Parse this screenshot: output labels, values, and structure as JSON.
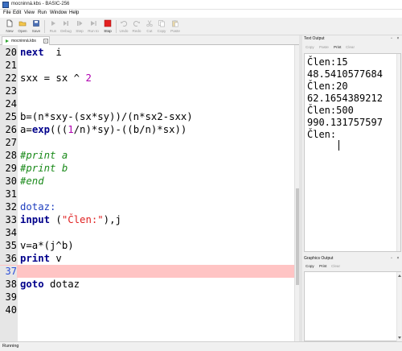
{
  "window": {
    "title": "mocninná.kbs - BASIC-256"
  },
  "menu": [
    "File",
    "Edit",
    "View",
    "Run",
    "Window",
    "Help"
  ],
  "toolbar": {
    "buttons": [
      {
        "label": "New",
        "icon": "new-file-icon",
        "enabled": true
      },
      {
        "label": "Open",
        "icon": "open-folder-icon",
        "enabled": true
      },
      {
        "label": "Save",
        "icon": "save-disk-icon",
        "enabled": true
      },
      {
        "label": "Run",
        "icon": "run-icon",
        "enabled": false
      },
      {
        "label": "Debug",
        "icon": "debug-icon",
        "enabled": false
      },
      {
        "label": "Step",
        "icon": "step-icon",
        "enabled": false
      },
      {
        "label": "Run to",
        "icon": "run-to-icon",
        "enabled": false
      },
      {
        "label": "Stop",
        "icon": "stop-icon",
        "enabled": true
      },
      {
        "label": "Undo",
        "icon": "undo-icon",
        "enabled": false
      },
      {
        "label": "Redo",
        "icon": "redo-icon",
        "enabled": false
      },
      {
        "label": "Cut",
        "icon": "cut-icon",
        "enabled": false
      },
      {
        "label": "Copy",
        "icon": "copy-icon",
        "enabled": false
      },
      {
        "label": "Paste",
        "icon": "paste-icon",
        "enabled": false
      }
    ]
  },
  "tab": {
    "name": "mocninná.kbs",
    "close": "x"
  },
  "editor": {
    "lines": [
      {
        "n": "20",
        "tokens": [
          [
            "kw",
            "next"
          ],
          [
            "",
            "  i"
          ]
        ]
      },
      {
        "n": "21",
        "tokens": []
      },
      {
        "n": "22",
        "tokens": [
          [
            "",
            "sxx = sx ^ "
          ],
          [
            "num-lit",
            "2"
          ]
        ]
      },
      {
        "n": "23",
        "tokens": []
      },
      {
        "n": "24",
        "tokens": []
      },
      {
        "n": "25",
        "tokens": [
          [
            "",
            "b=(n*sxy-(sx*sy))/(n*sx2-sxx)"
          ]
        ]
      },
      {
        "n": "26",
        "tokens": [
          [
            "",
            "a="
          ],
          [
            "kw",
            "exp"
          ],
          [
            "",
            "((("
          ],
          [
            "num-lit",
            "1"
          ],
          [
            "",
            "/n)*sy)-((b/n)*sx))"
          ]
        ]
      },
      {
        "n": "27",
        "tokens": []
      },
      {
        "n": "28",
        "tokens": [
          [
            "cmt",
            "#print a"
          ]
        ]
      },
      {
        "n": "29",
        "tokens": [
          [
            "cmt",
            "#print b"
          ]
        ]
      },
      {
        "n": "30",
        "tokens": [
          [
            "cmt",
            "#end"
          ]
        ]
      },
      {
        "n": "31",
        "tokens": []
      },
      {
        "n": "32",
        "tokens": [
          [
            "lbl",
            "dotaz:"
          ]
        ]
      },
      {
        "n": "33",
        "tokens": [
          [
            "kw",
            "input"
          ],
          [
            "",
            " ("
          ],
          [
            "str",
            "\"Člen:\""
          ],
          [
            "",
            "),j"
          ]
        ]
      },
      {
        "n": "34",
        "tokens": []
      },
      {
        "n": "35",
        "tokens": [
          [
            "",
            "v=a*(j^b)"
          ]
        ]
      },
      {
        "n": "36",
        "tokens": [
          [
            "kw",
            "print"
          ],
          [
            "",
            " v"
          ]
        ]
      },
      {
        "n": "37",
        "tokens": [],
        "highlight": true
      },
      {
        "n": "38",
        "tokens": [
          [
            "kw",
            "goto"
          ],
          [
            "",
            " dotaz"
          ]
        ]
      },
      {
        "n": "39",
        "tokens": []
      },
      {
        "n": "40",
        "tokens": []
      }
    ]
  },
  "text_output": {
    "title": "Text Output",
    "actions": [
      {
        "label": "Copy",
        "enabled": false
      },
      {
        "label": "Paste",
        "enabled": false
      },
      {
        "label": "Print",
        "enabled": true
      },
      {
        "label": "Clear",
        "enabled": false
      }
    ],
    "lines": [
      "Člen:15",
      "48.5410577684",
      "Člen:20",
      "62.1654389212",
      "Člen:500",
      "990.131757597",
      "Člen:"
    ]
  },
  "graphics_output": {
    "title": "Graphics Output",
    "actions": [
      {
        "label": "Copy",
        "enabled": true
      },
      {
        "label": "Print",
        "enabled": true
      },
      {
        "label": "Clear",
        "enabled": false
      }
    ]
  },
  "status": {
    "text": "Running"
  },
  "colors": {
    "highlight_line": "#ffc4c4",
    "keyword": "#00008b",
    "number": "#b000b0",
    "string": "#e02020",
    "comment": "#1a8a1a",
    "label": "#1f3fbf",
    "stop": "#e32020"
  }
}
